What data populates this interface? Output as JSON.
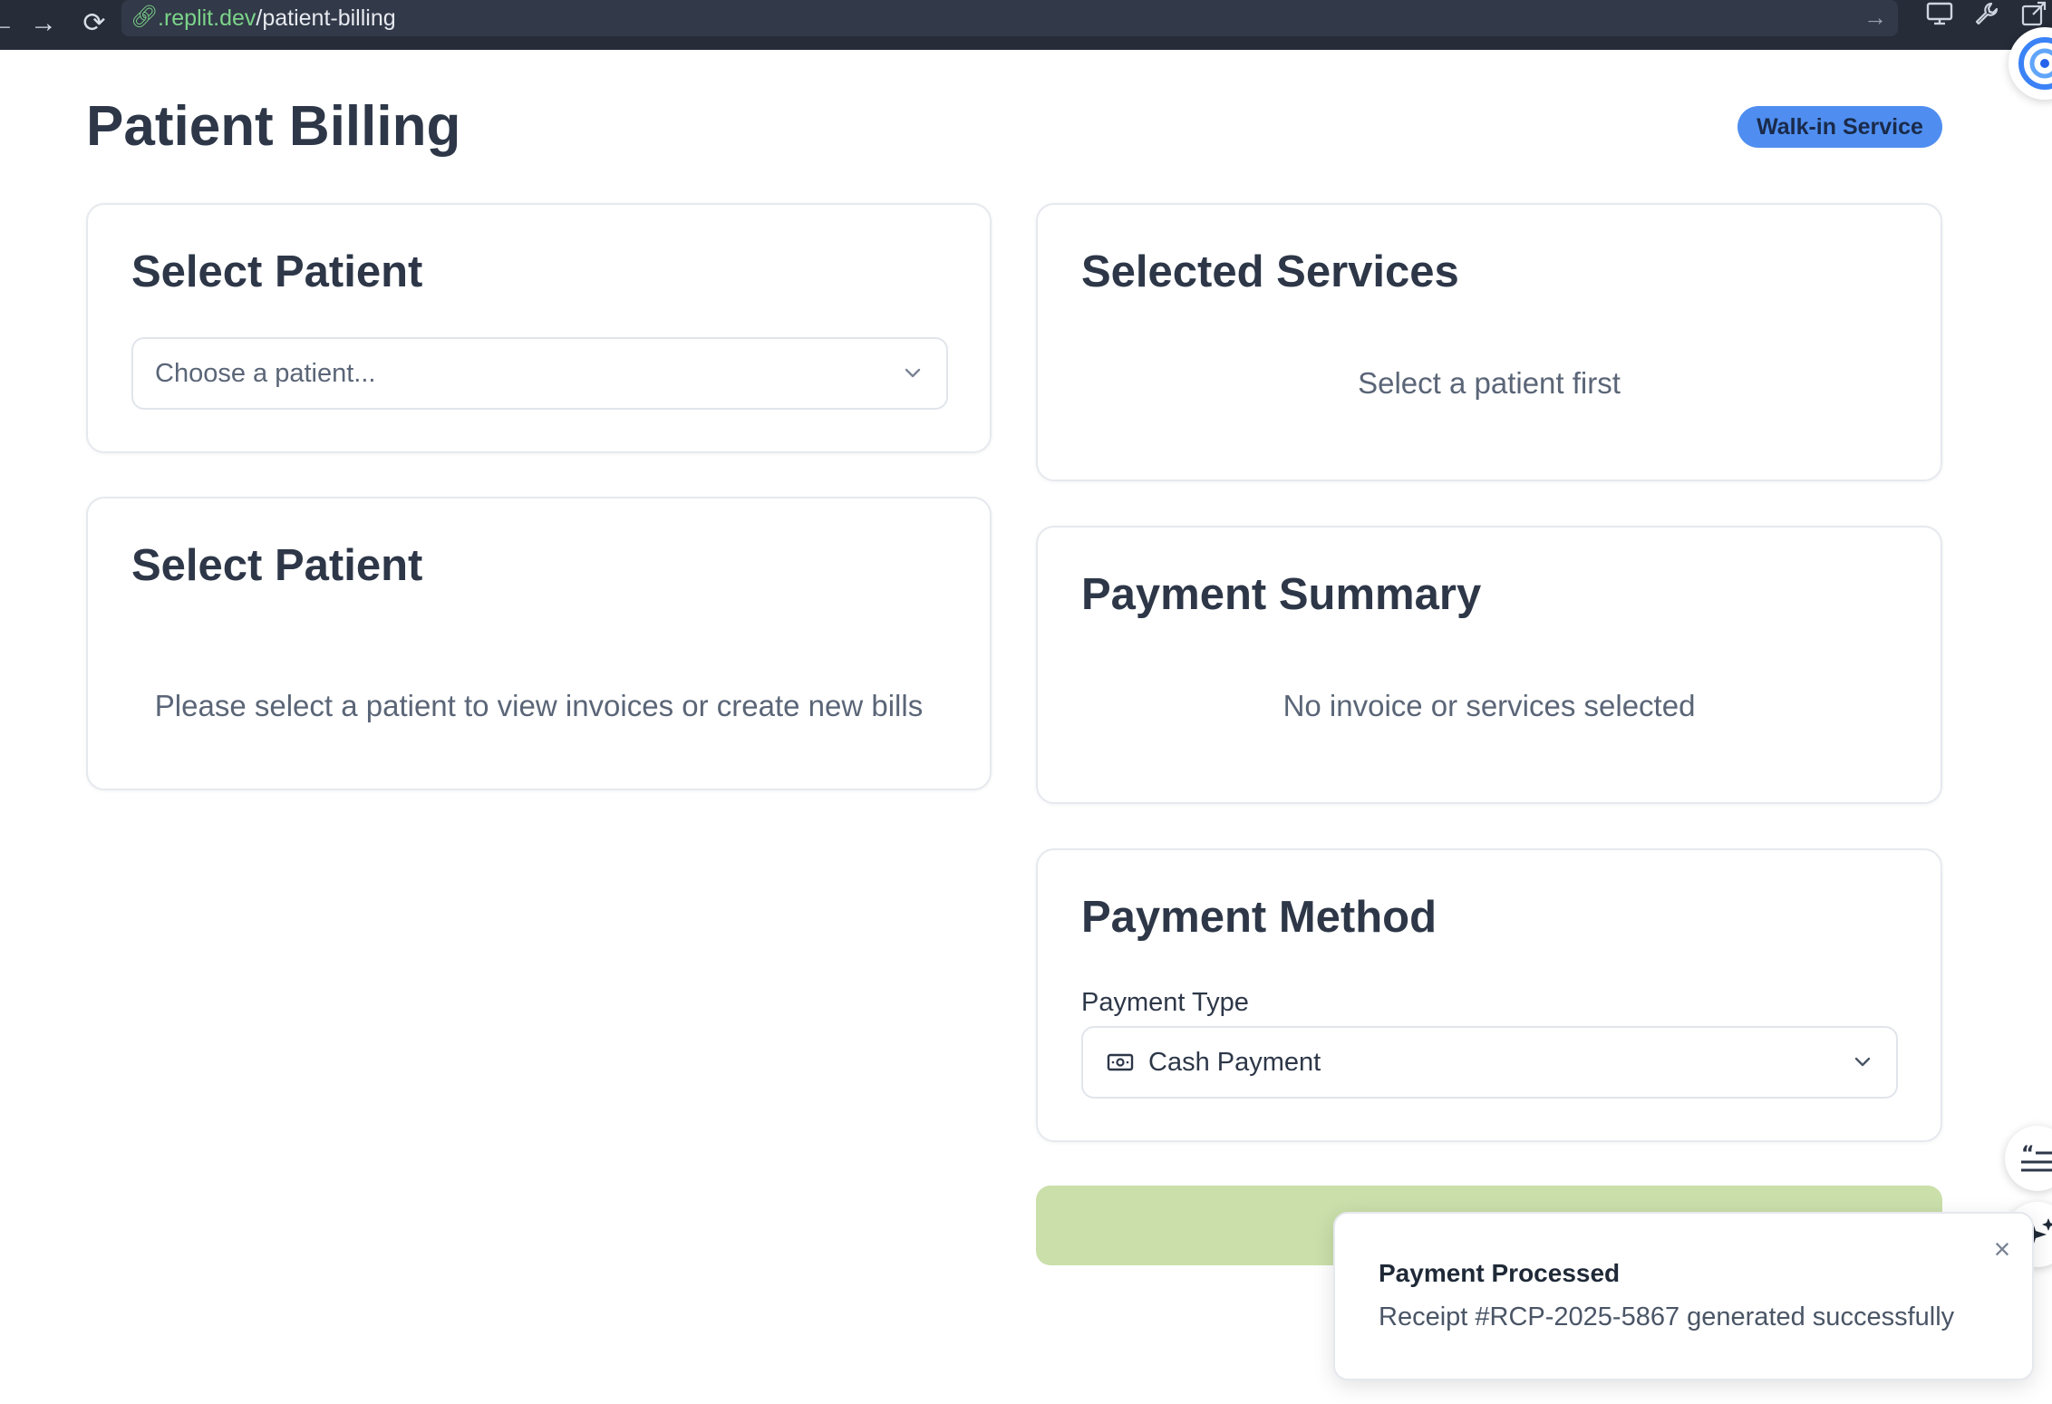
{
  "browser": {
    "url_host": ".replit.dev",
    "url_path": "/patient-billing",
    "icons": [
      "back-arrow-icon",
      "forward-arrow-icon",
      "reload-icon",
      "link-icon",
      "go-arrow-icon",
      "monitor-icon",
      "wrench-icon",
      "external-link-icon"
    ]
  },
  "header": {
    "title": "Patient Billing",
    "badge": "Walk-in Service"
  },
  "select_patient_card": {
    "title": "Select Patient",
    "dropdown_placeholder": "Choose a patient..."
  },
  "invoices_card": {
    "title": "Select Patient",
    "empty_message": "Please select a patient to view invoices or create new bills"
  },
  "services_card": {
    "title": "Selected Services",
    "empty_message": "Select a patient first"
  },
  "summary_card": {
    "title": "Payment Summary",
    "empty_message": "No invoice or services selected"
  },
  "payment_method_card": {
    "title": "Payment Method",
    "payment_type_label": "Payment Type",
    "payment_type_value": "Cash Payment",
    "payment_type_icon": "cash-icon"
  },
  "toast": {
    "title": "Payment Processed",
    "message": "Receipt #RCP-2025-5867 generated successfully"
  },
  "colors": {
    "badge": "#4f8ef0",
    "process_button": "#cadfaa",
    "url_host": "#7bd389",
    "topbar": "#262c38"
  }
}
